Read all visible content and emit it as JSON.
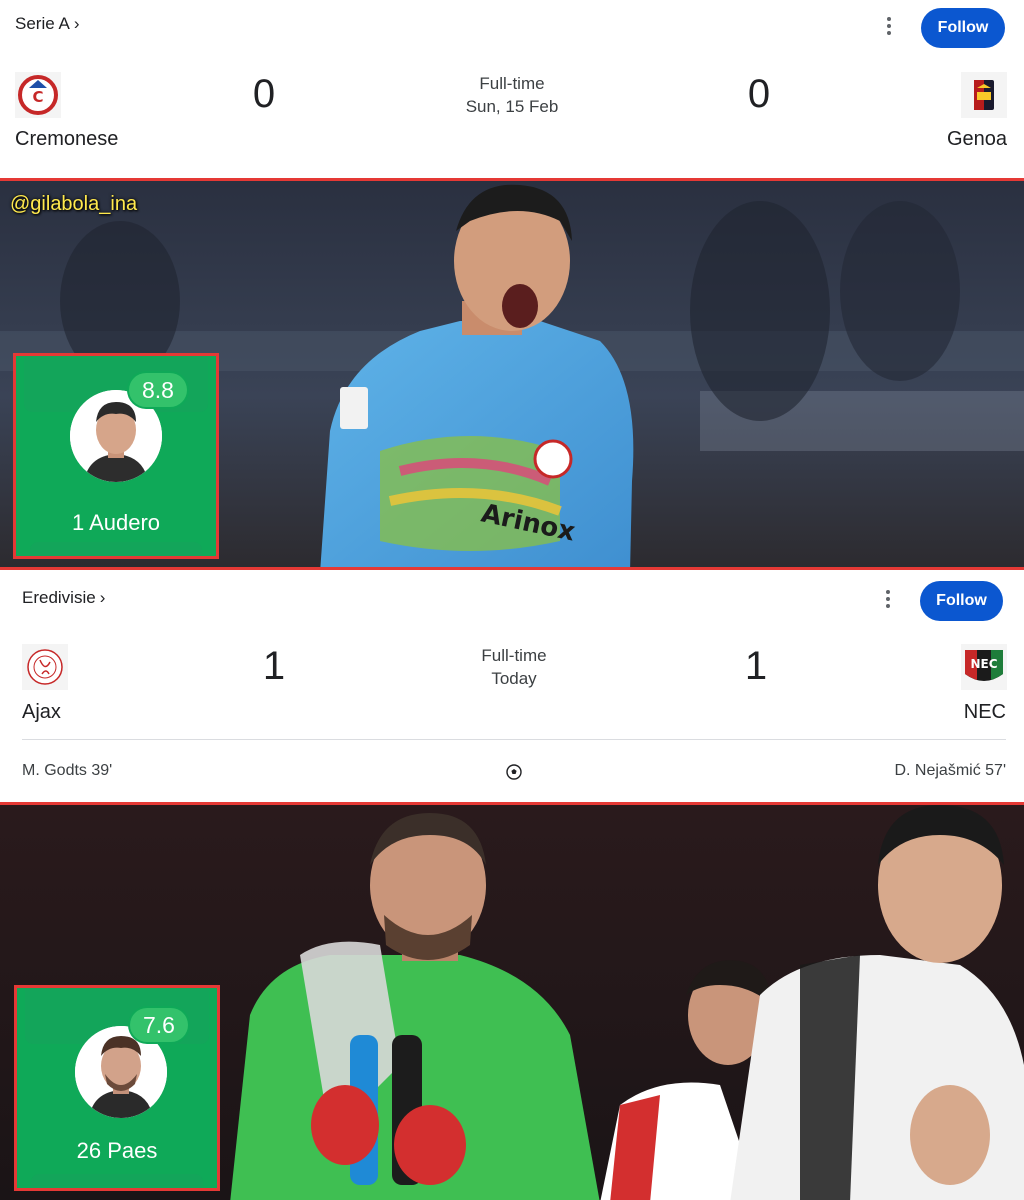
{
  "match1": {
    "league": "Serie A",
    "chevron": "›",
    "menu_icon": "more-vert-icon",
    "follow_label": "Follow",
    "home": {
      "name": "Cremonese",
      "score": "0",
      "crest_icon": "cremonese-crest-icon"
    },
    "away": {
      "name": "Genoa",
      "score": "0",
      "crest_icon": "genoa-crest-icon"
    },
    "status": "Full-time",
    "date": "Sun, 15 Feb"
  },
  "photo1": {
    "watermark": "@gilabola_ina",
    "player": {
      "rating": "8.8",
      "name": "1 Audero"
    }
  },
  "match2": {
    "league": "Eredivisie",
    "chevron": "›",
    "menu_icon": "more-vert-icon",
    "follow_label": "Follow",
    "home": {
      "name": "Ajax",
      "score": "1",
      "crest_icon": "ajax-crest-icon",
      "scorer": "M. Godts 39'"
    },
    "away": {
      "name": "NEC",
      "score": "1",
      "crest_icon": "nec-crest-icon",
      "scorer": "D. Nejašmić 57'"
    },
    "status": "Full-time",
    "date": "Today",
    "goal_icon": "soccer-ball-icon"
  },
  "photo2": {
    "player": {
      "rating": "7.6",
      "name": "26 Paes"
    }
  },
  "colors": {
    "follow_blue": "#0b57d0",
    "rating_green": "#0fa958",
    "badge_green": "#33c26b",
    "highlight_red": "#e53935",
    "watermark_yellow": "#ffe94d"
  }
}
